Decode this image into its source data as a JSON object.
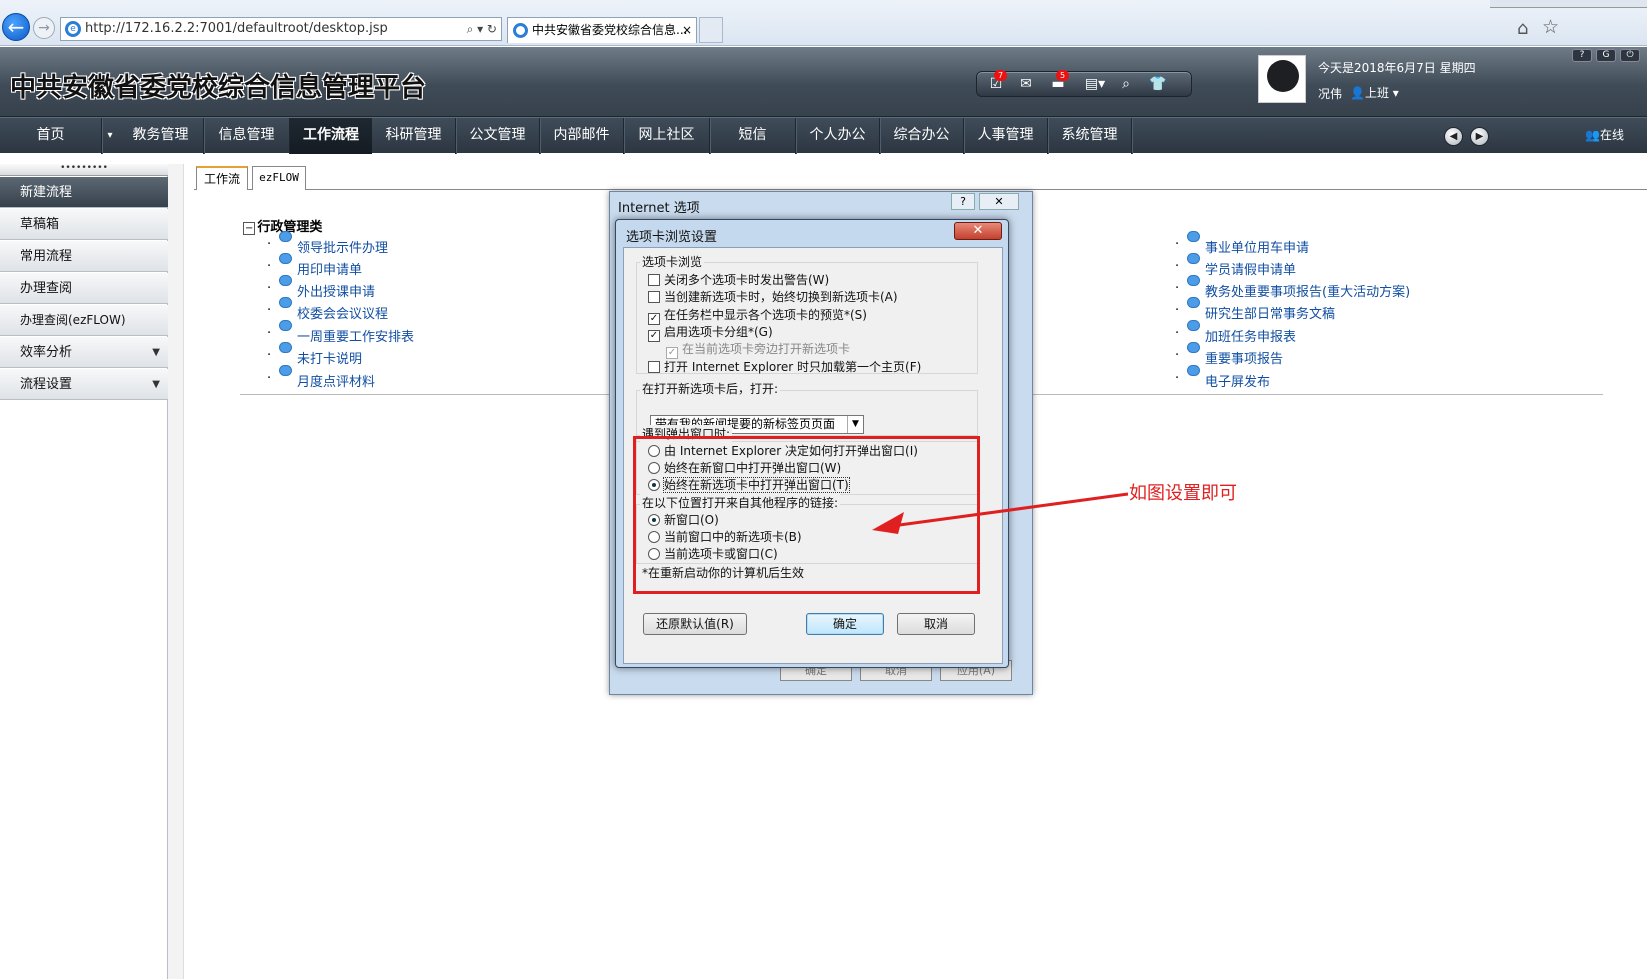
{
  "browser": {
    "url": "http://172.16.2.2:7001/defaultroot/desktop.jsp",
    "url_tools": "⌕ ▾ ↻",
    "tab_title": "中共安徽省委党校综合信息...",
    "tab_close": "×"
  },
  "header": {
    "title": "中共安徽省委党校综合信息管理平台",
    "toolbar": {
      "badge_tasks": "7",
      "badge_briefcase": "5"
    },
    "date": "今天是2018年6月7日 星期四",
    "user_name": "况伟",
    "user_status": "上班 ▾"
  },
  "nav": {
    "items": [
      "首页",
      "教务管理",
      "信息管理",
      "工作流程",
      "科研管理",
      "公文管理",
      "内部邮件",
      "网上社区",
      "短信",
      "个人办公",
      "综合办公",
      "人事管理",
      "系统管理"
    ],
    "online": "在线"
  },
  "sidebar": {
    "items": [
      "新建流程",
      "草稿箱",
      "常用流程",
      "办理查阅",
      "办理查阅(ezFLOW)",
      "效率分析",
      "流程设置"
    ]
  },
  "content": {
    "tabs": [
      "工作流",
      "ezFLOW"
    ],
    "category": "行政管理类",
    "left_links": [
      "领导批示件办理",
      "用印申请单",
      "外出授课申请",
      "校委会会议议程",
      "一周重要工作安排表",
      "未打卡说明",
      "月度点评材料"
    ],
    "right_links": [
      "事业单位用车申请",
      "学员请假申请单",
      "教务处重要事项报告(重大活动方案)",
      "研究生部日常事务文稿",
      "加班任务申报表",
      "重要事项报告",
      "电子屏发布"
    ]
  },
  "internet_options": {
    "title": "Internet 选项",
    "help": "?",
    "close": "✕",
    "buttons": [
      "确定",
      "取消",
      "应用(A)"
    ]
  },
  "tab_settings": {
    "title": "选项卡浏览设置",
    "close": "✕",
    "group1_label": "选项卡浏览",
    "checkboxes": [
      {
        "label": "关闭多个选项卡时发出警告(W)",
        "checked": false
      },
      {
        "label": "当创建新选项卡时，始终切换到新选项卡(A)",
        "checked": false
      },
      {
        "label": "在任务栏中显示各个选项卡的预览*(S)",
        "checked": true
      },
      {
        "label": "启用选项卡分组*(G)",
        "checked": true
      },
      {
        "label": "在当前选项卡旁边打开新选项卡",
        "checked": true
      },
      {
        "label": "打开 Internet Explorer 时只加载第一个主页(F)",
        "checked": false
      }
    ],
    "open_label": "在打开新选项卡后，打开:",
    "open_value": "带有我的新闻提要的新标签页页面",
    "popup_label": "遇到弹出窗口时:",
    "popup_options": [
      "由 Internet Explorer 决定如何打开弹出窗口(I)",
      "始终在新窗口中打开弹出窗口(W)",
      "始终在新选项卡中打开弹出窗口(T)"
    ],
    "popup_selected": 2,
    "links_label": "在以下位置打开来自其他程序的链接:",
    "links_options": [
      "新窗口(O)",
      "当前窗口中的新选项卡(B)",
      "当前选项卡或窗口(C)"
    ],
    "links_selected": 0,
    "note": "*在重新启动你的计算机后生效",
    "btn_restore": "还原默认值(R)",
    "btn_ok": "确定",
    "btn_cancel": "取消"
  },
  "annotation": {
    "text": "如图设置即可",
    "color": "#e02020"
  }
}
